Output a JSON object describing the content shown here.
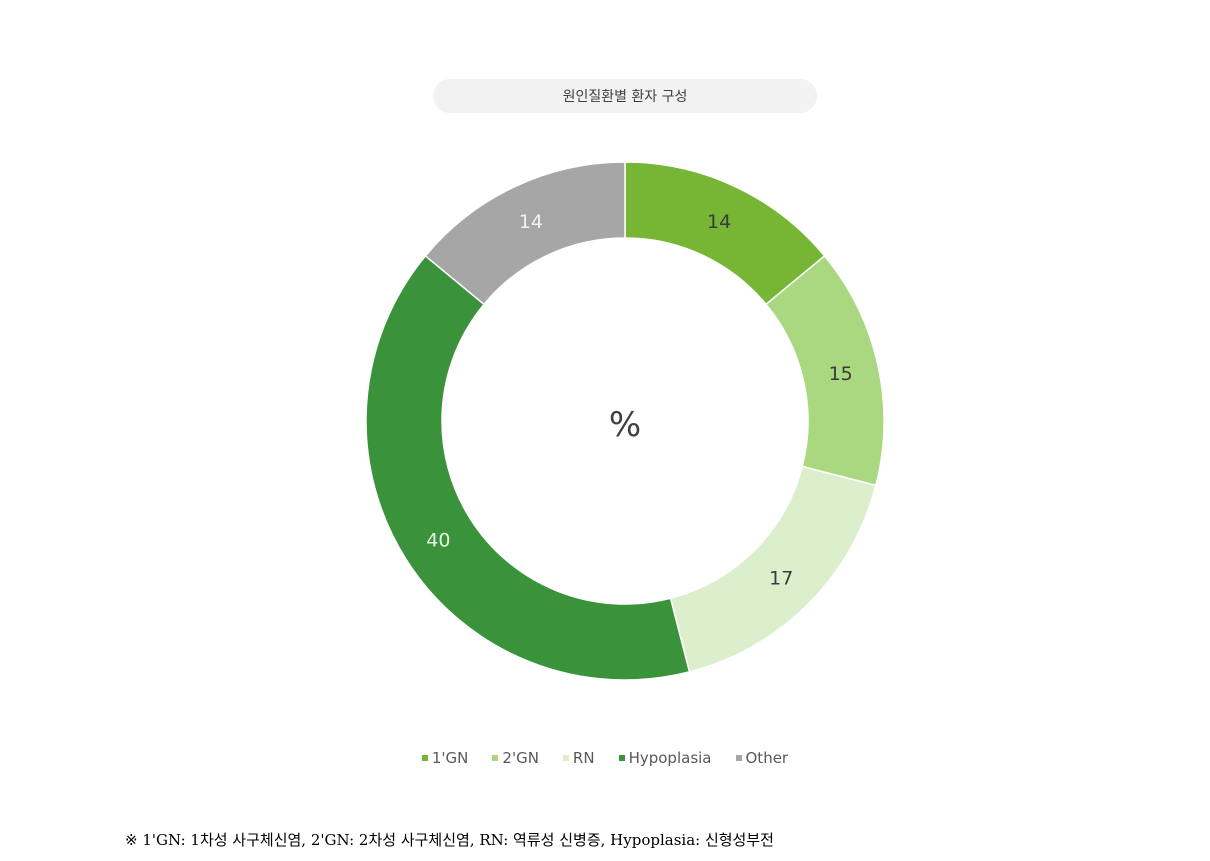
{
  "chart_data": {
    "type": "pie",
    "variant": "donut",
    "title": "원인질환별 환자 구성",
    "center_label": "%",
    "categories": [
      "1'GN",
      "2'GN",
      "RN",
      "Hypoplasia",
      "Other"
    ],
    "values": [
      14,
      15,
      17,
      40,
      14
    ],
    "colors": [
      "#76b634",
      "#a9d881",
      "#dbefcd",
      "#3a923a",
      "#a6a6a6"
    ],
    "label_colors": [
      "#3b3b3b",
      "#3b3b3b",
      "#3b3b3b",
      "#e8f4e0",
      "#f2f2f2"
    ],
    "start": "top, clockwise",
    "legend_position": "bottom"
  },
  "footnote": "※  1'GN: 1차성 사구체신염, 2'GN: 2차성 사구체신염, RN: 역류성 신병증, Hypoplasia: 신형성부전"
}
